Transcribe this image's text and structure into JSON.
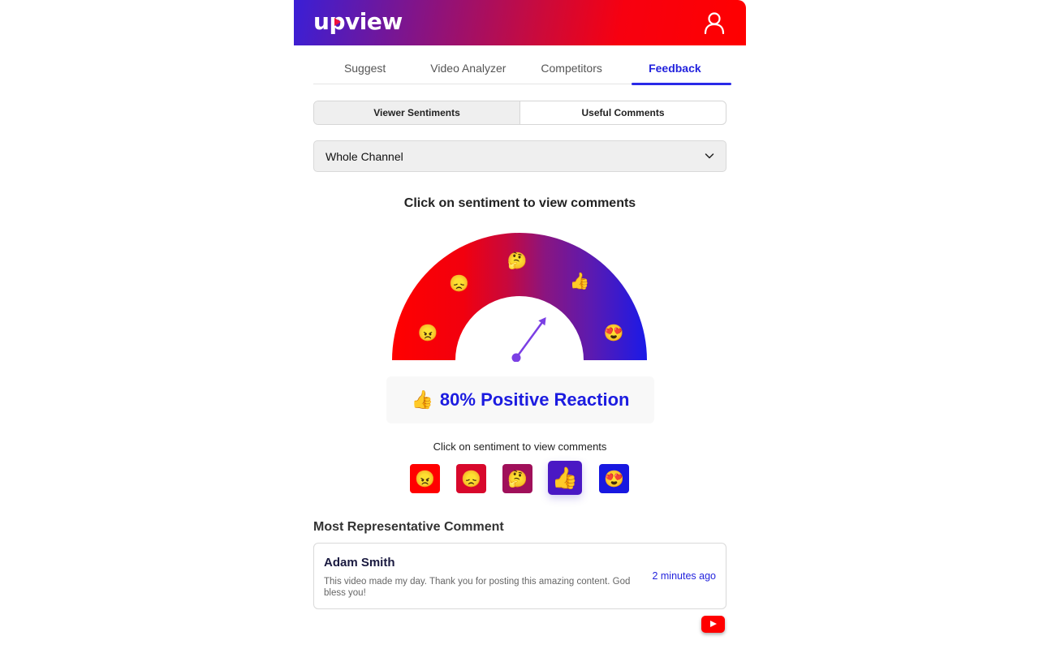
{
  "header": {
    "logo_text_pre": "u",
    "logo_text_mid": "p",
    "logo_text_post": "view",
    "user_icon": "user-icon"
  },
  "tabs": [
    {
      "label": "Suggest",
      "active": false
    },
    {
      "label": "Video Analyzer",
      "active": false
    },
    {
      "label": "Competitors",
      "active": false
    },
    {
      "label": "Feedback",
      "active": true
    }
  ],
  "segmented": [
    {
      "label": "Viewer Sentiments",
      "active": true
    },
    {
      "label": "Useful Comments",
      "active": false
    }
  ],
  "scope_select": {
    "value": "Whole Channel",
    "icon": "chevron-down-icon"
  },
  "gauge": {
    "title": "Click on sentiment to view comments",
    "value_percent": 80,
    "gradient_colors": [
      "#ff0000",
      "#c8083c",
      "#8a1580",
      "#5c1ab0",
      "#1a1ae8"
    ],
    "needle_color": "#7b3fe4",
    "sentiments": [
      {
        "name": "angry",
        "emoji": "😠"
      },
      {
        "name": "sad",
        "emoji": "😞"
      },
      {
        "name": "thinking",
        "emoji": "🤔"
      },
      {
        "name": "thumbs-up",
        "emoji": "👍"
      },
      {
        "name": "love",
        "emoji": "😍"
      }
    ]
  },
  "result": {
    "emoji": "👍",
    "text": "80% Positive Reaction"
  },
  "sentiment_picker": {
    "title": "Click on sentiment to view comments",
    "buttons": [
      {
        "name": "angry",
        "emoji": "😠",
        "color": "#ff0000",
        "active": false
      },
      {
        "name": "sad",
        "emoji": "😞",
        "color": "#d8082c",
        "active": false
      },
      {
        "name": "thinking",
        "emoji": "🤔",
        "color": "#a0105a",
        "active": false
      },
      {
        "name": "thumbs-up",
        "emoji": "👍",
        "color": "#4a18c4",
        "active": true
      },
      {
        "name": "love",
        "emoji": "😍",
        "color": "#1818e0",
        "active": false
      }
    ]
  },
  "representative": {
    "title": "Most Representative Comment",
    "author": "Adam Smith",
    "text": "This video made my day. Thank you for posting this amazing content. God bless you!",
    "time": "2 minutes ago",
    "source_icon": "youtube-icon"
  }
}
